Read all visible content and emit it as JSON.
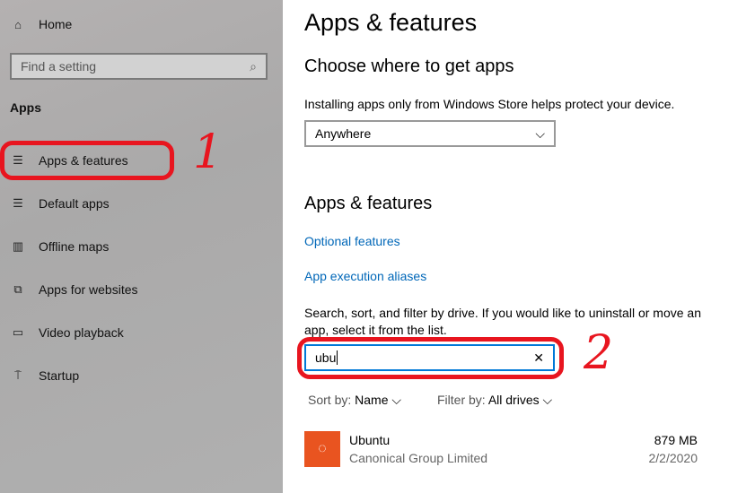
{
  "sidebar": {
    "home": "Home",
    "search_placeholder": "Find a setting",
    "section": "Apps",
    "items": [
      {
        "label": "Apps & features",
        "icon": "apps-features-icon"
      },
      {
        "label": "Default apps",
        "icon": "default-apps-icon"
      },
      {
        "label": "Offline maps",
        "icon": "map-icon"
      },
      {
        "label": "Apps for websites",
        "icon": "apps-websites-icon"
      },
      {
        "label": "Video playback",
        "icon": "video-icon"
      },
      {
        "label": "Startup",
        "icon": "startup-icon"
      }
    ]
  },
  "annotations": {
    "one": "1",
    "two": "2",
    "color": "#e8151f"
  },
  "main": {
    "title": "Apps & features",
    "choose_heading": "Choose where to get apps",
    "choose_desc": "Installing apps only from Windows Store helps protect your device.",
    "source_value": "Anywhere",
    "section_heading": "Apps & features",
    "link_optional": "Optional features",
    "link_aliases": "App execution aliases",
    "search_desc": "Search, sort, and filter by drive. If you would like to uninstall or move an app, select it from the list.",
    "search_value": "ubu",
    "sort_label": "Sort by:",
    "sort_value": "Name",
    "filter_label": "Filter by:",
    "filter_value": "All drives",
    "apps": [
      {
        "name": "Ubuntu",
        "publisher": "Canonical Group Limited",
        "size": "879 MB",
        "date": "2/2/2020",
        "color": "#e95420"
      }
    ]
  }
}
